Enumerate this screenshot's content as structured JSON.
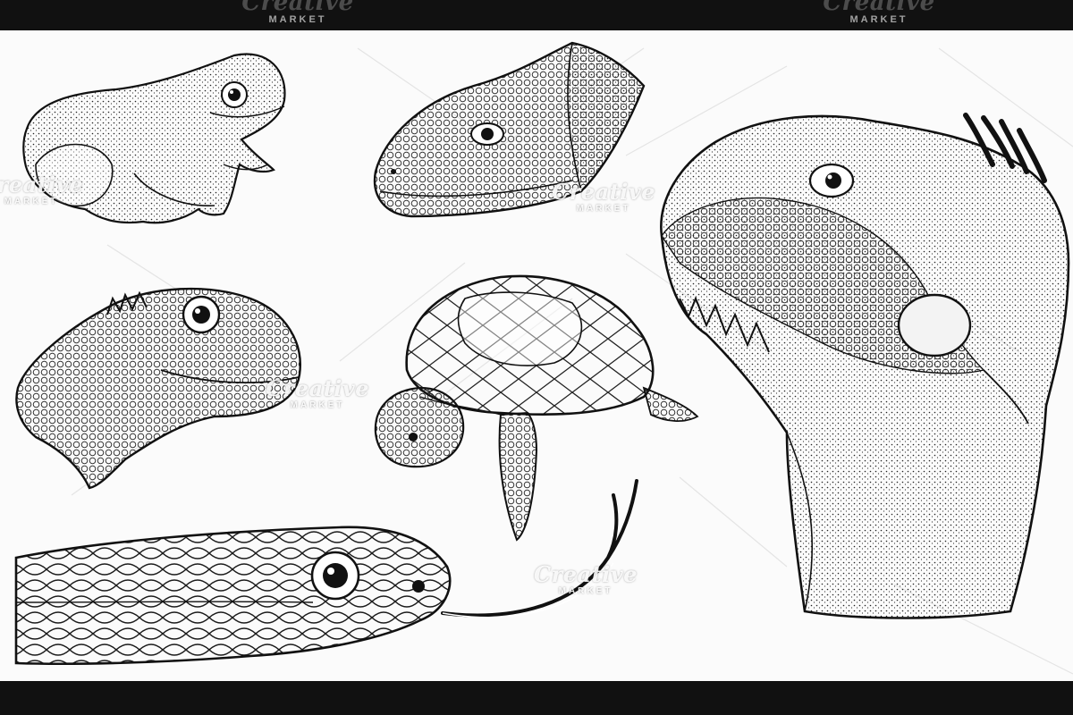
{
  "watermark": {
    "logo": "Creative",
    "sub": "MARKET"
  },
  "palette": {
    "background": "#fbfbfb",
    "ink": "#1b1b1b",
    "frame": "#111111"
  },
  "illustrations": [
    "frog",
    "lizard-head",
    "iguana-head",
    "agama-head",
    "tortoise",
    "snake-head"
  ]
}
